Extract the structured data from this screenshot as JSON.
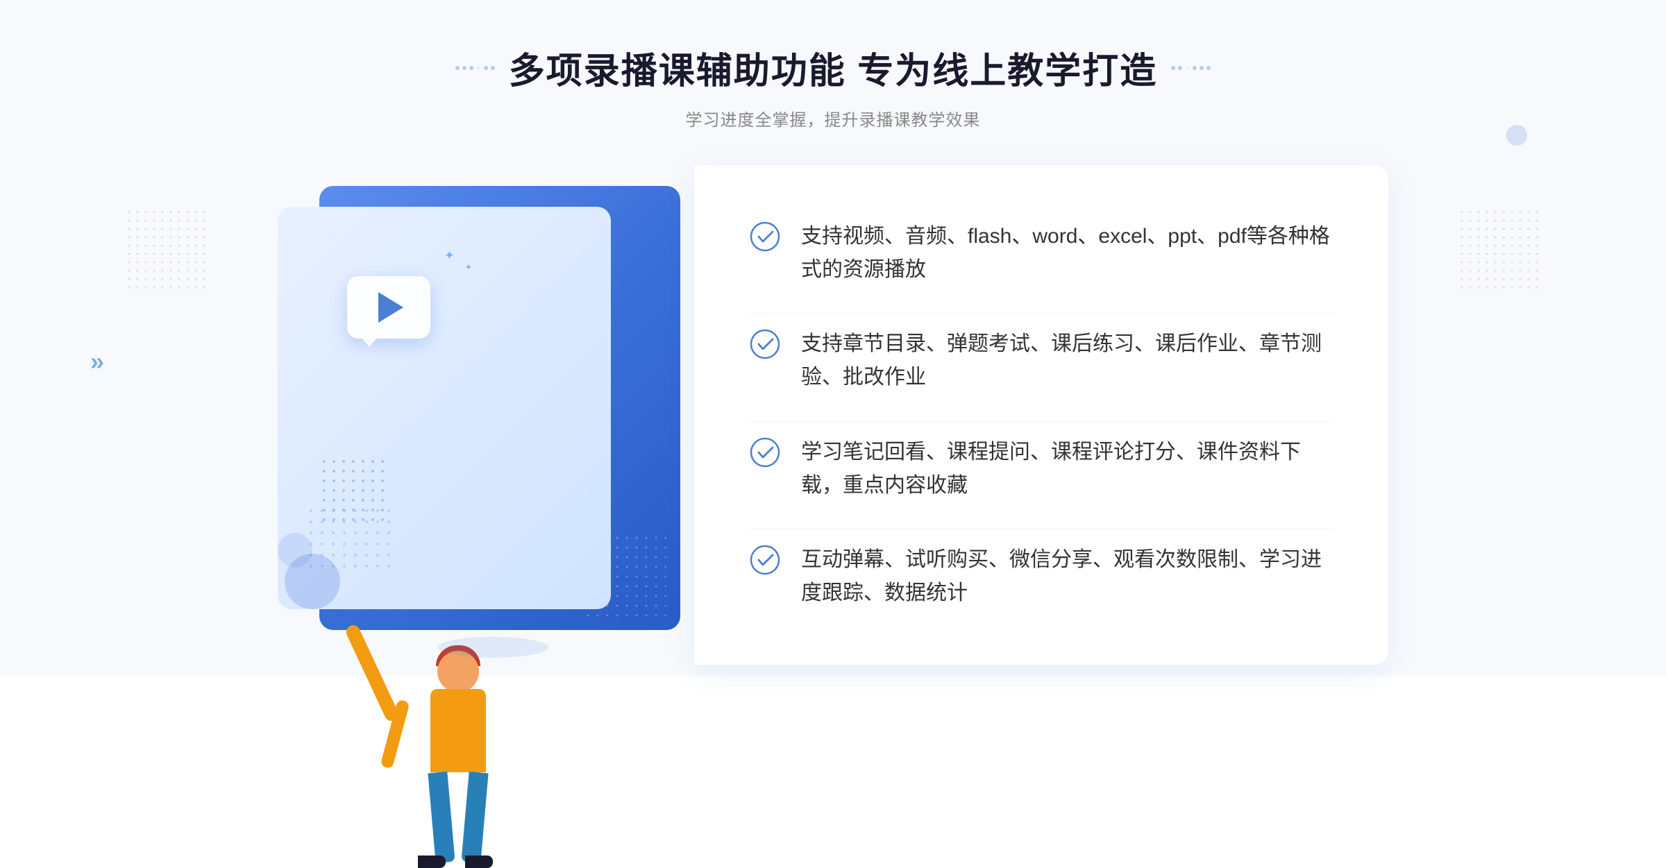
{
  "page": {
    "background": "#f8f9fc"
  },
  "header": {
    "main_title": "多项录播课辅助功能 专为线上教学打造",
    "sub_title": "学习进度全掌握，提升录播课教学效果"
  },
  "features": [
    {
      "id": 1,
      "text": "支持视频、音频、flash、word、excel、ppt、pdf等各种格式的资源播放"
    },
    {
      "id": 2,
      "text": "支持章节目录、弹题考试、课后练习、课后作业、章节测验、批改作业"
    },
    {
      "id": 3,
      "text": "学习笔记回看、课程提问、课程评论打分、课件资料下载，重点内容收藏"
    },
    {
      "id": 4,
      "text": "互动弹幕、试听购买、微信分享、观看次数限制、学习进度跟踪、数据统计"
    }
  ],
  "icons": {
    "check": "check-circle-icon",
    "play": "play-icon",
    "chevron_left": "«",
    "chevron_right": "»"
  },
  "colors": {
    "primary_blue": "#4a7fd4",
    "light_blue": "#e8f0ff",
    "gradient_start": "#5b8dee",
    "gradient_end": "#2a5bc8",
    "text_dark": "#1a1a2e",
    "text_gray": "#888888",
    "text_body": "#333333"
  }
}
